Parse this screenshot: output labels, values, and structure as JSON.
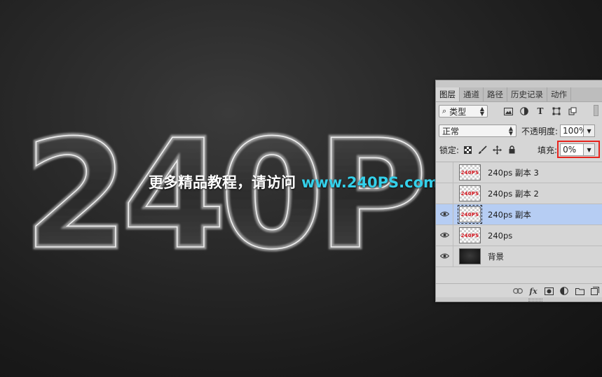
{
  "canvas": {
    "artwork_text": "240P",
    "watermark_text": "更多精品教程，请访问",
    "watermark_url": "www.240PS.com"
  },
  "layers_panel": {
    "tabs": [
      {
        "label": "图层",
        "active": true
      },
      {
        "label": "通道",
        "active": false
      },
      {
        "label": "路径",
        "active": false
      },
      {
        "label": "历史记录",
        "active": false
      },
      {
        "label": "动作",
        "active": false
      }
    ],
    "filter": {
      "search_glyph": "⌕",
      "kind_label": "类型",
      "icons": [
        "image-filter-icon",
        "adjustment-filter-icon",
        "type-filter-icon",
        "shape-filter-icon",
        "smart-object-filter-icon"
      ]
    },
    "blend_mode": "正常",
    "opacity_label": "不透明度:",
    "opacity_value": "100%",
    "lock_label": "锁定:",
    "fill_label": "填充:",
    "fill_value": "0%",
    "layers": [
      {
        "name": "240ps  副本 3",
        "visible": false,
        "selected": false,
        "thumb": "240PS",
        "type": "transparent"
      },
      {
        "name": "240ps  副本 2",
        "visible": false,
        "selected": false,
        "thumb": "240PS",
        "type": "transparent"
      },
      {
        "name": "240ps  副本",
        "visible": true,
        "selected": true,
        "thumb": "240PS",
        "type": "transparent"
      },
      {
        "name": "240ps",
        "visible": true,
        "selected": false,
        "thumb": "240PS",
        "type": "transparent"
      },
      {
        "name": "背景",
        "visible": true,
        "selected": false,
        "thumb": "",
        "type": "dark"
      }
    ],
    "footer_icons": [
      "link-layers-icon",
      "fx-icon",
      "add-mask-icon",
      "adjustment-layer-icon",
      "new-group-icon",
      "new-layer-icon"
    ],
    "footer_fx_label": "fx",
    "colors": {
      "selected_row": "#b6cdf3",
      "highlight_box": "#e8241d",
      "url_cyan": "#34d0ea"
    }
  }
}
